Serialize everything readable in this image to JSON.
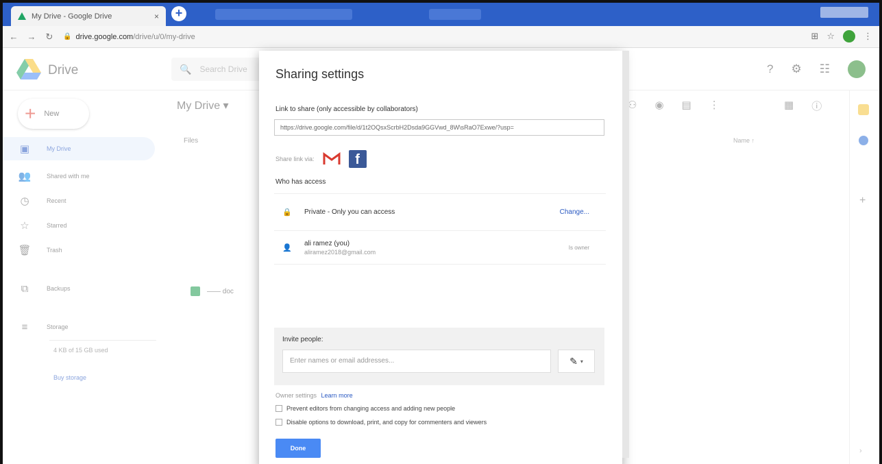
{
  "browser": {
    "tab_title": "My Drive - Google Drive",
    "tab_close": "×",
    "new_tab": "+",
    "url_host": "drive.google.com",
    "url_path": "/drive/u/0/my-drive"
  },
  "drive": {
    "app_name": "Drive",
    "search_placeholder": "Search Drive"
  },
  "sidebar": {
    "new_label": "New",
    "items": [
      {
        "label": "My Drive",
        "icon": "my-drive-icon",
        "glyph": "▣"
      },
      {
        "label": "Shared with me",
        "icon": "people-icon",
        "glyph": "👥"
      },
      {
        "label": "Recent",
        "icon": "clock-icon",
        "glyph": "◷"
      },
      {
        "label": "Starred",
        "icon": "star-icon",
        "glyph": "☆"
      },
      {
        "label": "Trash",
        "icon": "trash-icon",
        "glyph": "🗑"
      },
      {
        "label": "Backups",
        "icon": "backup-icon",
        "glyph": "⧉"
      },
      {
        "label": "Storage",
        "icon": "storage-icon",
        "glyph": "≡"
      }
    ],
    "storage_text": "4 KB of 15 GB used",
    "buy_storage": "Buy storage"
  },
  "main": {
    "title": "My Drive",
    "files_label": "Files",
    "name_sort": "Name ↑",
    "file_name": "—— doc"
  },
  "dialog": {
    "title": "Sharing settings",
    "link_label": "Link to share (only accessible by collaborators)",
    "link_value": "https://drive.google.com/file/d/1t2OQsxScrbH2Dsda9GGVwd_8W\\sRaO7Exwe/?usp=",
    "share_via": "Share link via:",
    "who_has_access": "Who has access",
    "access": [
      {
        "name": "Private - Only you can access",
        "action": "Change..."
      },
      {
        "name": "ali ramez (you)",
        "email": "aliramez2018@gmail.com",
        "action": "Is owner"
      }
    ],
    "invite_label": "Invite people:",
    "invite_placeholder": "Enter names or email addresses...",
    "owner_settings": "Owner settings",
    "learn_more": "Learn more",
    "checkbox1": "Prevent editors from changing access and adding new people",
    "checkbox2": "Disable options to download, print, and copy for commenters and viewers",
    "done": "Done"
  }
}
